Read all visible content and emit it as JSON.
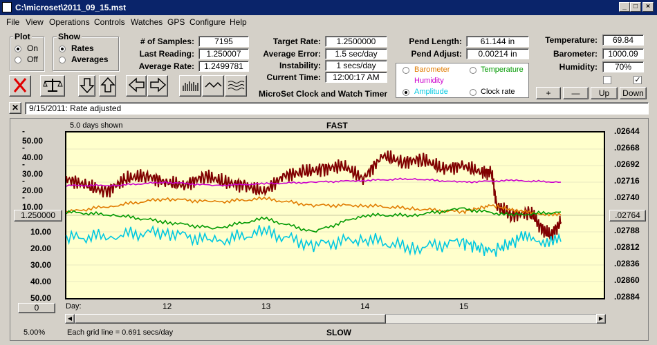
{
  "window": {
    "title": "C:\\microset\\2011_09_15.mst"
  },
  "menu": [
    "File",
    "View",
    "Operations",
    "Controls",
    "Watches",
    "GPS",
    "Configure",
    "Help"
  ],
  "plot_group": {
    "title": "Plot",
    "options": [
      "On",
      "Off"
    ],
    "selected": "On"
  },
  "show_group": {
    "title": "Show",
    "options": [
      "Rates",
      "Averages"
    ],
    "selected": "Rates"
  },
  "stats": {
    "samples_label": "# of Samples:",
    "samples": "7195",
    "last_reading_label": "Last Reading:",
    "last_reading": "1.250007",
    "average_rate_label": "Average Rate:",
    "average_rate": "1.2499781",
    "target_rate_label": "Target Rate:",
    "target_rate": "1.2500000",
    "average_error_label": "Average Error:",
    "average_error": "1.5 sec/day",
    "instability_label": "Instability:",
    "instability": "1 secs/day",
    "current_time_label": "Current Time:",
    "current_time": "12:00:17 AM",
    "pend_length_label": "Pend Length:",
    "pend_length": "61.144 in",
    "pend_adjust_label": "Pend Adjust:",
    "pend_adjust": "0.00214 in",
    "temperature_label": "Temperature:",
    "temperature": "69.84",
    "barometer_label": "Barometer:",
    "barometer": "1000.09",
    "humidity_label": "Humidity:",
    "humidity": "70%"
  },
  "app_name": "MicroSet Clock and Watch Timer",
  "series_options": [
    {
      "label": "Barometer",
      "color": "#e07b00",
      "selected": false
    },
    {
      "label": "Temperature",
      "color": "#009900",
      "selected": false
    },
    {
      "label": "Humidity",
      "color": "#cc00cc",
      "selected": false
    },
    {
      "label": "Amplitude",
      "color": "#00c8e0",
      "selected": true
    },
    {
      "label": "Clock rate",
      "color": "#000000",
      "selected": false
    }
  ],
  "adjust_buttons": [
    "+",
    "—",
    "Up",
    "Down"
  ],
  "log": {
    "message": "9/15/2011: Rate adjusted"
  },
  "chart": {
    "days_shown": "5.0 days shown",
    "top_label": "FAST",
    "bottom_label": "SLOW",
    "center_value": "1.250000",
    "center_right": ".02764",
    "grid_note": "Each grid line = 0.691 secs/day",
    "zoom": "5.00%",
    "scroll_box": "0",
    "day_label": "Day:"
  },
  "chart_data": {
    "type": "line",
    "left_ticks": [
      "- 50.00",
      "- 40.00",
      "- 30.00",
      "- 20.00",
      "- 10.00",
      "",
      "10.00",
      "20.00",
      "30.00",
      "40.00",
      "50.00"
    ],
    "right_ticks": [
      ".02644",
      ".02668",
      ".02692",
      ".02716",
      ".02740",
      ".02764",
      ".02788",
      ".02812",
      ".02836",
      ".02860",
      ".02884"
    ],
    "x_ticks": [
      "12",
      "13",
      "14",
      "15"
    ],
    "x_range": [
      11.0,
      16.0
    ],
    "y_range": [
      -50,
      50
    ],
    "series": [
      {
        "color": "#800000",
        "values": [
          [
            11.0,
            -22
          ],
          [
            11.2,
            -18
          ],
          [
            11.4,
            -14
          ],
          [
            11.6,
            -22
          ],
          [
            11.8,
            -24
          ],
          [
            12.0,
            -20
          ],
          [
            12.2,
            -18
          ],
          [
            12.4,
            -24
          ],
          [
            12.6,
            -20
          ],
          [
            12.8,
            -18
          ],
          [
            13.0,
            -14
          ],
          [
            13.2,
            -24
          ],
          [
            13.4,
            -26
          ],
          [
            13.6,
            -28
          ],
          [
            13.8,
            -30
          ],
          [
            14.0,
            -22
          ],
          [
            14.2,
            -36
          ],
          [
            14.4,
            -32
          ],
          [
            14.6,
            -34
          ],
          [
            14.8,
            -28
          ],
          [
            15.0,
            -30
          ],
          [
            15.2,
            -26
          ],
          [
            15.3,
            -26
          ],
          [
            15.35,
            -6
          ],
          [
            15.5,
            0
          ],
          [
            15.7,
            -2
          ],
          [
            15.8,
            8
          ],
          [
            15.9,
            12
          ],
          [
            16.0,
            4
          ]
        ]
      },
      {
        "color": "#cc00cc",
        "values": [
          [
            11.0,
            -18
          ],
          [
            11.5,
            -18
          ],
          [
            12.0,
            -20
          ],
          [
            12.5,
            -18
          ],
          [
            13.0,
            -19
          ],
          [
            13.5,
            -20
          ],
          [
            14.0,
            -21
          ],
          [
            14.5,
            -22
          ],
          [
            15.0,
            -20
          ],
          [
            15.5,
            -21
          ],
          [
            16.0,
            -20
          ]
        ]
      },
      {
        "color": "#e07b00",
        "values": [
          [
            11.0,
            -2
          ],
          [
            11.5,
            -6
          ],
          [
            12.0,
            -10
          ],
          [
            12.5,
            -8
          ],
          [
            13.0,
            -10
          ],
          [
            13.5,
            -6
          ],
          [
            14.0,
            -6
          ],
          [
            14.5,
            -4
          ],
          [
            15.0,
            -2
          ],
          [
            15.3,
            -6
          ],
          [
            15.6,
            -2
          ],
          [
            16.0,
            0
          ]
        ]
      },
      {
        "color": "#009900",
        "values": [
          [
            11.0,
            -2
          ],
          [
            11.5,
            0
          ],
          [
            12.0,
            4
          ],
          [
            12.5,
            8
          ],
          [
            13.0,
            2
          ],
          [
            13.5,
            10
          ],
          [
            14.0,
            0
          ],
          [
            14.5,
            0
          ],
          [
            15.0,
            -4
          ],
          [
            15.5,
            0
          ],
          [
            16.0,
            -2
          ]
        ]
      },
      {
        "color": "#00c8e0",
        "values": [
          [
            11.0,
            14
          ],
          [
            11.5,
            12
          ],
          [
            12.0,
            10
          ],
          [
            12.5,
            16
          ],
          [
            13.0,
            10
          ],
          [
            13.5,
            18
          ],
          [
            14.0,
            14
          ],
          [
            14.5,
            20
          ],
          [
            15.0,
            16
          ],
          [
            15.3,
            22
          ],
          [
            15.6,
            14
          ],
          [
            16.0,
            16
          ]
        ]
      }
    ]
  }
}
